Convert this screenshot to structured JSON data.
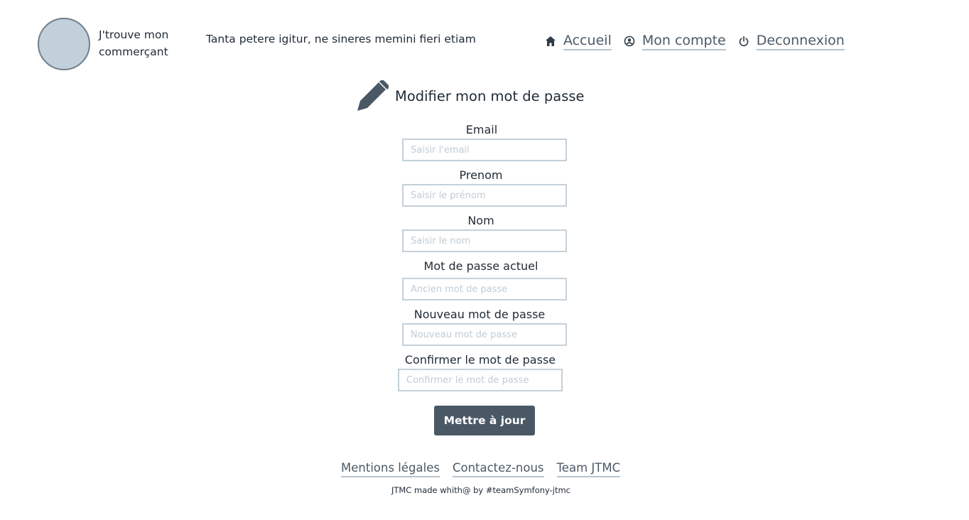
{
  "header": {
    "brand": "J'trouve mon commerçant",
    "tagline": "Tanta petere igitur, ne sineres memini fieri etiam",
    "nav": [
      {
        "label": "Accueil",
        "icon": "home-icon"
      },
      {
        "label": "Mon compte",
        "icon": "user-circle-icon"
      },
      {
        "label": "Deconnexion",
        "icon": "power-icon"
      }
    ]
  },
  "form": {
    "title": "Modifier mon mot de passe",
    "title_icon": "pencil-icon",
    "fields": [
      {
        "label": "Email",
        "placeholder": "Saisir l'email",
        "value": ""
      },
      {
        "label": "Prenom",
        "placeholder": "Saisir le prénom",
        "value": ""
      },
      {
        "label": "Nom",
        "placeholder": "Saisir le nom",
        "value": ""
      },
      {
        "label": "Mot de passe actuel",
        "placeholder": "Ancien mot de passe",
        "value": ""
      },
      {
        "label": "Nouveau mot de passe",
        "placeholder": "Nouveau mot de passe",
        "value": ""
      },
      {
        "label": "Confirmer le mot de passe",
        "placeholder": "Confirmer le mot de passe",
        "value": ""
      }
    ],
    "submit_label": "Mettre à jour"
  },
  "footer": {
    "links": [
      "Mentions légales",
      "Contactez-nous",
      "Team JTMC"
    ],
    "credits": "JTMC made whith@ by #teamSymfony-jtmc"
  },
  "colors": {
    "accent": "#4a5866",
    "link": "#4a5a68",
    "logo_fill": "#c3cfd9",
    "input_border": "#c5d0d8"
  }
}
